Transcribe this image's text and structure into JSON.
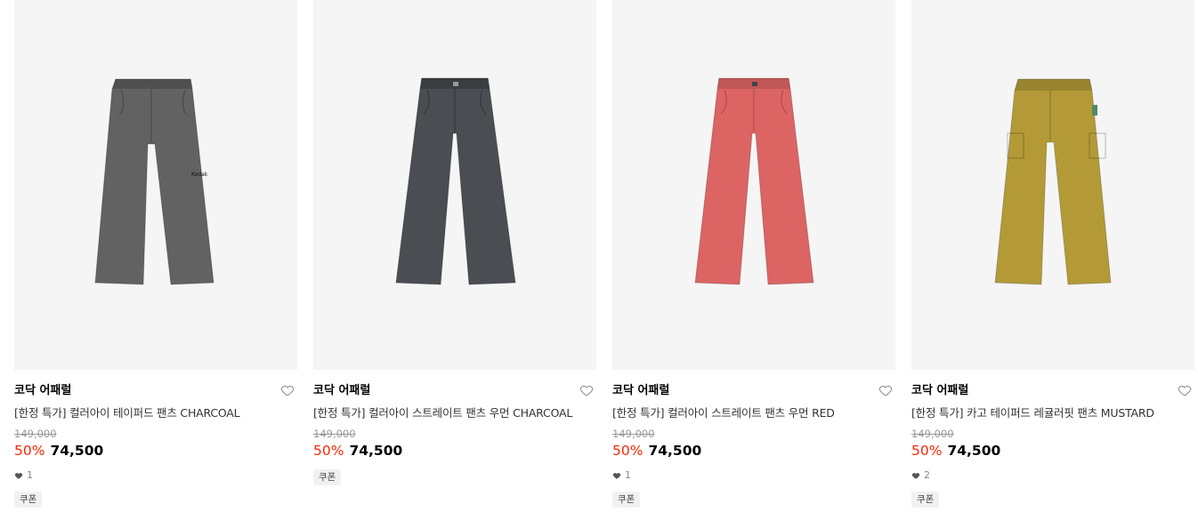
{
  "products": [
    {
      "brand": "코닥 어패럴",
      "title": "[한정 특가] 컬러아이 테이퍼드 팬츠 CHARCOAL",
      "original_price": "149,000",
      "discount": "50%",
      "price": "74,500",
      "likes": "1",
      "badge": "쿠폰",
      "color": "#626262",
      "style": "tapered-elastic"
    },
    {
      "brand": "코닥 어패럴",
      "title": "[한정 특가] 컬러아이 스트레이트 팬츠 우먼 CHARCOAL",
      "original_price": "149,000",
      "discount": "50%",
      "price": "74,500",
      "likes": "",
      "badge": "쿠폰",
      "color": "#4a4e52",
      "style": "straight"
    },
    {
      "brand": "코닥 어패럴",
      "title": "[한정 특가] 컬러아이 스트레이트 팬츠 우먼 RED",
      "original_price": "149,000",
      "discount": "50%",
      "price": "74,500",
      "likes": "1",
      "badge": "쿠폰",
      "color": "#dc6463",
      "style": "straight"
    },
    {
      "brand": "코닥 어패럴",
      "title": "[한정 특가] 카고 테이퍼드 레귤러핏 팬츠 MUSTARD",
      "original_price": "149,000",
      "discount": "50%",
      "price": "74,500",
      "likes": "2",
      "badge": "쿠폰",
      "color": "#b39a37",
      "style": "cargo"
    }
  ]
}
